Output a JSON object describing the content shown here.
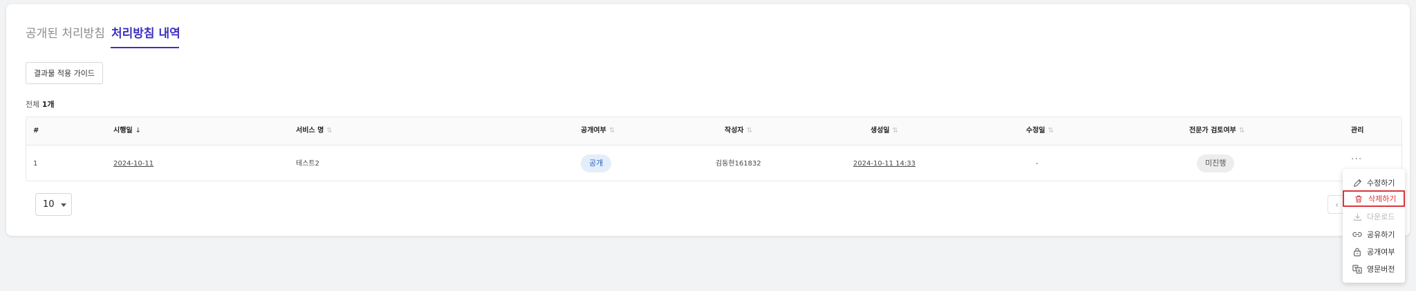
{
  "tabs": [
    {
      "label": "공개된 처리방침"
    },
    {
      "label": "처리방침 내역"
    }
  ],
  "guide_button": {
    "label": "결과물 적용 가이드"
  },
  "total": {
    "prefix": "전체",
    "count": "1개"
  },
  "table": {
    "headers": {
      "index": "#",
      "effective_date": "시행일",
      "service_name": "서비스 명",
      "public_status": "공개여부",
      "author": "작성자",
      "created_at": "생성일",
      "modified_at": "수정일",
      "expert_review": "전문가 검토여부",
      "manage": "관리"
    },
    "rows": [
      {
        "index": "1",
        "effective_date": "2024-10-11",
        "service_name": "테스트2",
        "public_status": "공개",
        "author": "김동현161832",
        "created_at": "2024-10-11 14:33",
        "modified_at": "-",
        "expert_review": "미진행",
        "manage": "···"
      }
    ]
  },
  "pagination": {
    "page_size": "10",
    "prev": "‹"
  },
  "context_menu": {
    "items": [
      {
        "label": "수정하기",
        "icon": "pencil-icon"
      },
      {
        "label": "삭제하기",
        "icon": "trash-icon"
      },
      {
        "label": "다운로드",
        "icon": "download-icon"
      },
      {
        "label": "공유하기",
        "icon": "link-icon"
      },
      {
        "label": "공개여부",
        "icon": "lock-icon"
      },
      {
        "label": "영문버전",
        "icon": "translate-icon"
      }
    ]
  },
  "colors": {
    "accent": "#3c2fc0",
    "danger": "#d9363e",
    "badge_public_bg": "#e4eefb"
  }
}
